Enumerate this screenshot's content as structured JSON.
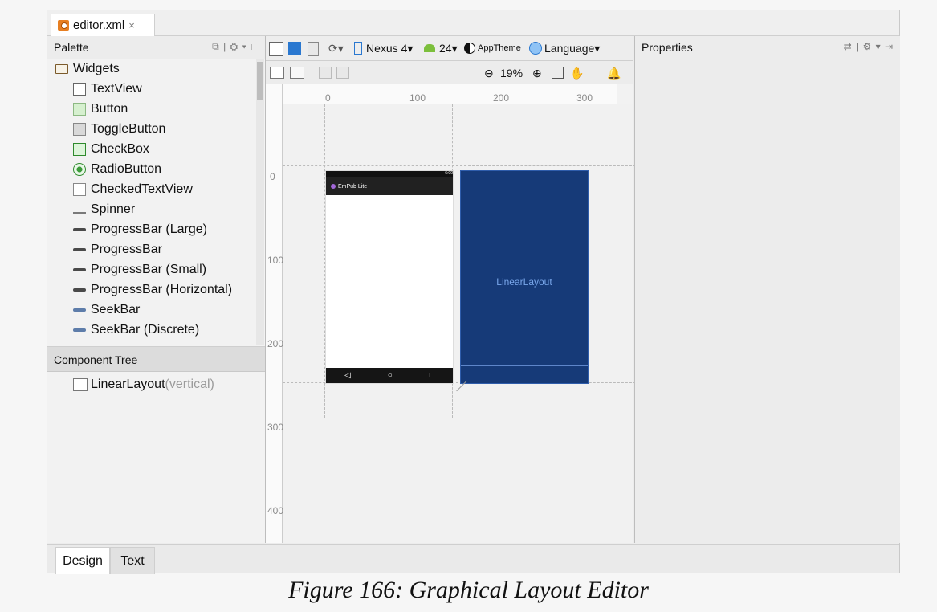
{
  "editor": {
    "tab": {
      "title": "editor.xml",
      "close": "×"
    },
    "palette": {
      "title": "Palette",
      "tools_text": "⧉ | ⚙ ▾ ⊢",
      "group_label": "Widgets",
      "items": [
        {
          "label": "TextView",
          "icon": "text-view-icon"
        },
        {
          "label": "Button",
          "icon": "button-icon"
        },
        {
          "label": "ToggleButton",
          "icon": "toggle-button-icon"
        },
        {
          "label": "CheckBox",
          "icon": "checkbox-icon"
        },
        {
          "label": "RadioButton",
          "icon": "radio-button-icon"
        },
        {
          "label": "CheckedTextView",
          "icon": "checked-text-view-icon"
        },
        {
          "label": "Spinner",
          "icon": "spinner-icon"
        },
        {
          "label": "ProgressBar (Large)",
          "icon": "progress-bar-icon"
        },
        {
          "label": "ProgressBar",
          "icon": "progress-bar-icon"
        },
        {
          "label": "ProgressBar (Small)",
          "icon": "progress-bar-icon"
        },
        {
          "label": "ProgressBar (Horizontal)",
          "icon": "progress-bar-icon"
        },
        {
          "label": "SeekBar",
          "icon": "seek-bar-icon"
        },
        {
          "label": "SeekBar (Discrete)",
          "icon": "seek-bar-icon"
        }
      ]
    },
    "component_tree": {
      "title": "Component Tree",
      "item": {
        "label": "LinearLayout",
        "hint": "(vertical)"
      }
    },
    "toolbar": {
      "device": "Nexus 4",
      "api": "24",
      "theme": "AppTheme",
      "language": "Language",
      "zoom": "19%"
    },
    "rulers": {
      "h_ticks": [
        "0",
        "100",
        "200",
        "300"
      ],
      "v_ticks": [
        "0",
        "100",
        "200",
        "300",
        "400"
      ]
    },
    "preview": {
      "status_text": "6:00",
      "appbar_text": "EmPub Lite",
      "blueprint_label": "LinearLayout"
    },
    "properties": {
      "title": "Properties",
      "tools_text": "⇄ | ⚙ ▾ ⇥"
    },
    "bottom_tabs": {
      "design": "Design",
      "text": "Text"
    }
  },
  "caption": "Figure 166: Graphical Layout Editor"
}
